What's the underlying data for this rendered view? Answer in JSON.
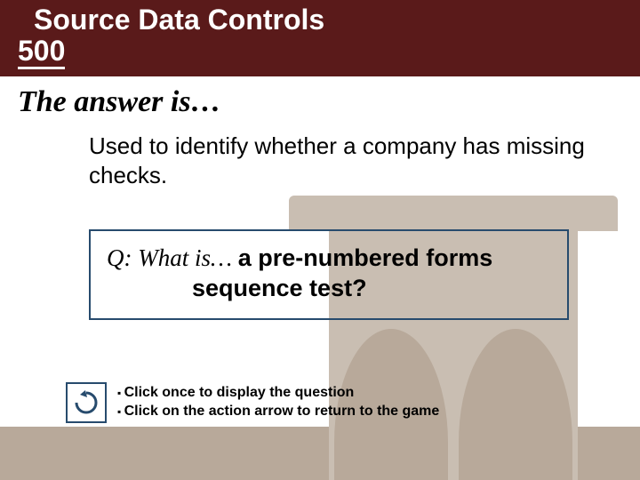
{
  "title": {
    "category": "Source Data Controls",
    "points": "500"
  },
  "lead": "The answer is…",
  "clue": "Used to identify whether a company has missing checks.",
  "question": {
    "prefix": "Q: What is… ",
    "answer_line1": "a pre-numbered forms",
    "answer_line2": "sequence test?"
  },
  "instructions": {
    "line1": "Click once to display the question",
    "line2": "Click on the action arrow to return to the game"
  },
  "icons": {
    "return": "return-arrow-icon"
  },
  "colors": {
    "header_bg": "#5a1a1a",
    "box_border": "#274b6d",
    "bg_shape": "#c9beb2",
    "bg_band": "#b8a99a"
  }
}
